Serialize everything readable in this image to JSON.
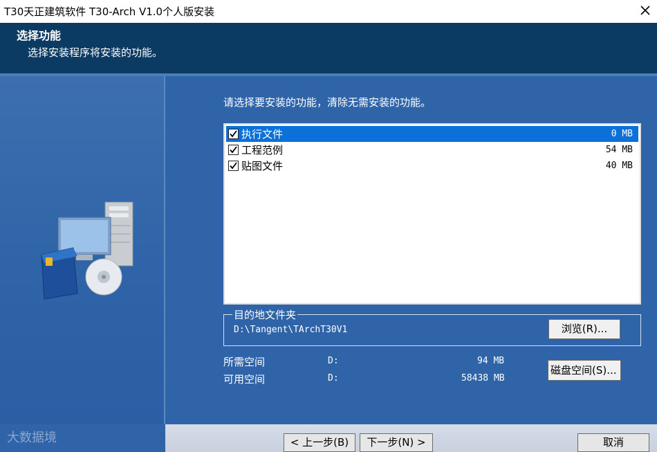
{
  "window": {
    "title": "T30天正建筑软件 T30-Arch V1.0个人版安装"
  },
  "header": {
    "title": "选择功能",
    "subtitle": "选择安装程序将安装的功能。"
  },
  "instruction": "请选择要安装的功能，清除无需安装的功能。",
  "features": [
    {
      "name": "执行文件",
      "size": "0 MB",
      "checked": true,
      "selected": true
    },
    {
      "name": "工程范例",
      "size": "54 MB",
      "checked": true,
      "selected": false
    },
    {
      "name": "贴图文件",
      "size": "40 MB",
      "checked": true,
      "selected": false
    }
  ],
  "destination": {
    "legend": "目的地文件夹",
    "path": "D:\\Tangent\\TArchT30V1",
    "browse_label": "浏览(R)..."
  },
  "space": {
    "required_label": "所需空间",
    "required_drive": "D:",
    "required_value": "94 MB",
    "available_label": "可用空间",
    "available_drive": "D:",
    "available_value": "58438 MB",
    "disk_button_label": "磁盘空间(S)..."
  },
  "nav": {
    "back_label": "< 上一步(B)",
    "next_label": "下一步(N) >",
    "cancel_label": "取消"
  },
  "watermark": "大数据境",
  "colors": {
    "header_bg": "#0b3a63",
    "panel_bg": "#2f65a8",
    "selection": "#0b70d8"
  }
}
